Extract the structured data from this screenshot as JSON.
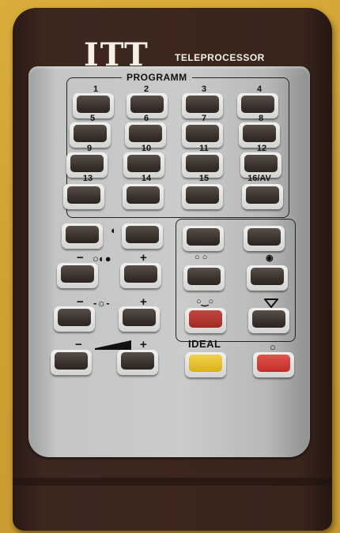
{
  "brand": "ITT",
  "model": "TELEPROCESSOR",
  "program_title": "PROGRAMM",
  "program_labels": [
    "1",
    "2",
    "3",
    "4",
    "5",
    "6",
    "7",
    "8",
    "9",
    "10",
    "11",
    "12",
    "13",
    "14",
    "15",
    "16/AV"
  ],
  "ideal_label": "IDEAL",
  "minus": "−",
  "plus": "+",
  "colors": {
    "body": "#3a251d",
    "panel": "#c6c8c7",
    "key": "#3b322e",
    "red_key": "#9d2a24",
    "yellow_key": "#d8b11c"
  }
}
